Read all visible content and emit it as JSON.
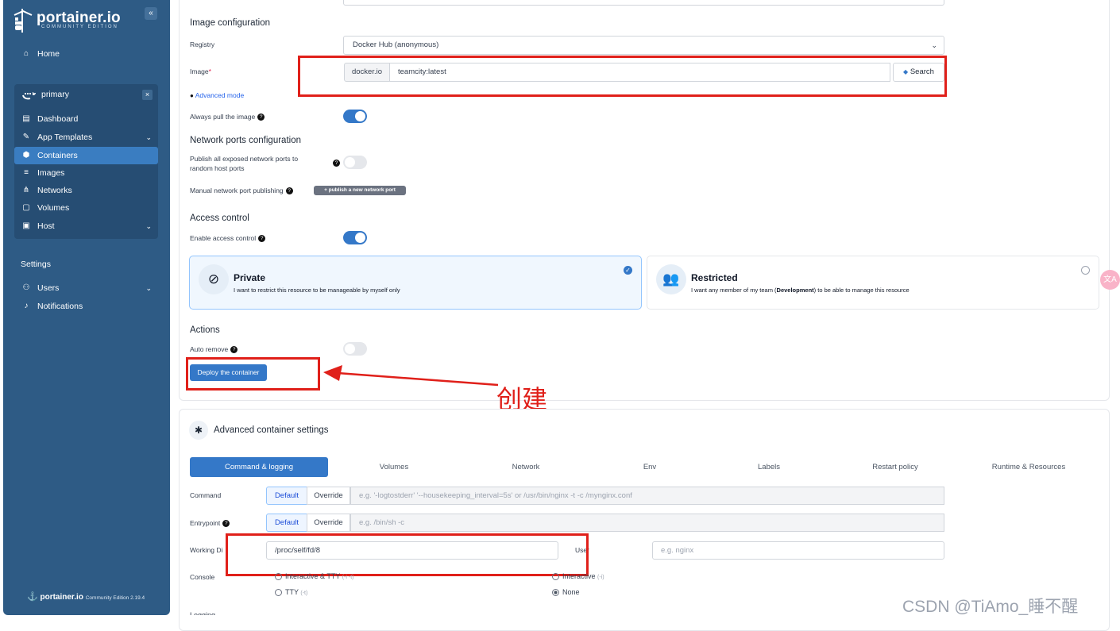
{
  "sidebar": {
    "logo": "portainer.io",
    "logo_sub": "COMMUNITY EDITION",
    "collapse": "«",
    "home": "Home",
    "environment": {
      "name": "primary",
      "close": "×"
    },
    "items": [
      {
        "label": "Dashboard",
        "icon": "dashboard-icon"
      },
      {
        "label": "App Templates",
        "icon": "edit-icon"
      },
      {
        "label": "Containers",
        "icon": "box-icon"
      },
      {
        "label": "Images",
        "icon": "list-icon"
      },
      {
        "label": "Networks",
        "icon": "share-icon"
      },
      {
        "label": "Volumes",
        "icon": "database-icon"
      },
      {
        "label": "Host",
        "icon": "server-icon"
      }
    ],
    "settings_title": "Settings",
    "users": "Users",
    "notifications": "Notifications",
    "footer_brand": "portainer.io",
    "footer_version": "Community Edition 2.19.4"
  },
  "image_config": {
    "title": "Image configuration",
    "registry_label": "Registry",
    "registry_value": "Docker Hub (anonymous)",
    "image_label": "Image",
    "image_required": "*",
    "image_prefix": "docker.io",
    "image_value": "teamcity:latest",
    "search_label": "Search",
    "advanced_mode": "Advanced mode",
    "always_pull": "Always pull the image"
  },
  "network_ports": {
    "title": "Network ports configuration",
    "publish_all_line1": "Publish all exposed network ports to",
    "publish_all_line2": "random host ports",
    "manual_label": "Manual network port publishing",
    "publish_button": "+ publish a new network port"
  },
  "access_control": {
    "title": "Access control",
    "enable_label": "Enable access control",
    "private_title": "Private",
    "private_desc": "I want to restrict this resource to be manageable by myself only",
    "restricted_title": "Restricted",
    "restricted_desc_pre": "I want any member of my team (",
    "restricted_team": "Development",
    "restricted_desc_post": ") to be able to manage this resource"
  },
  "actions": {
    "title": "Actions",
    "auto_remove": "Auto remove",
    "deploy": "Deploy the container"
  },
  "annotation": "创建",
  "advanced": {
    "title": "Advanced container settings",
    "tabs": [
      "Command & logging",
      "Volumes",
      "Network",
      "Env",
      "Labels",
      "Restart policy",
      "Runtime & Resources"
    ],
    "command_label": "Command",
    "entrypoint_label": "Entrypoint",
    "default": "Default",
    "override": "Override",
    "command_placeholder": "e.g. '-logtostderr' '--housekeeping_interval=5s' or /usr/bin/nginx -t -c /mynginx.conf",
    "entrypoint_placeholder": "e.g. /bin/sh -c",
    "working_dir_label": "Working Di",
    "working_dir_value": "/proc/self/fd/8",
    "user_label": "User",
    "user_placeholder": "e.g. nginx",
    "console_label": "Console",
    "console_options": [
      "Interactive & TTY",
      "TTY",
      "Interactive",
      "None"
    ],
    "console_hints": [
      "(-i -t)",
      "(-t)",
      "(-i)",
      ""
    ],
    "console_selected": "None",
    "logging_label": "Logging"
  },
  "watermark": "CSDN @TiAmo_睡不醒"
}
